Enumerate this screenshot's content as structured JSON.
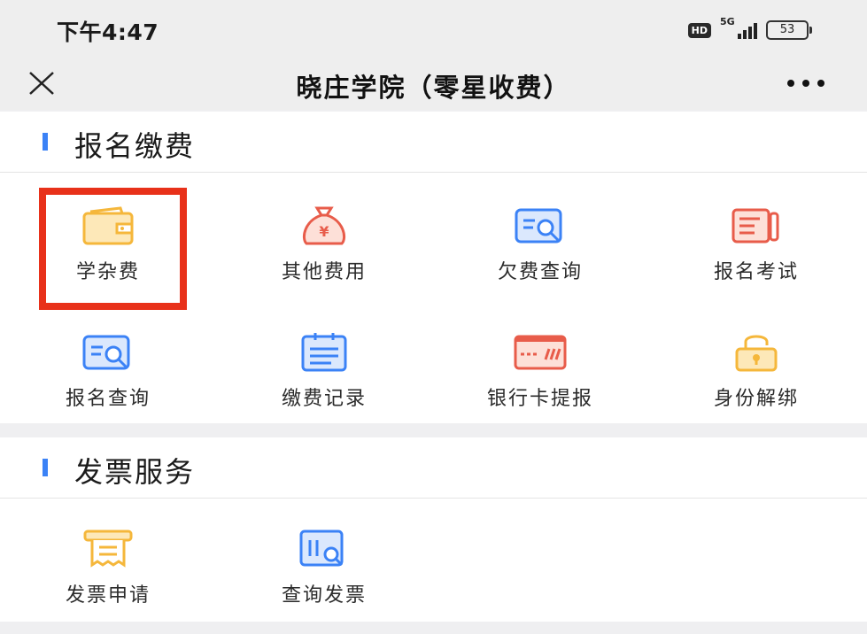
{
  "status_bar": {
    "time": "下午4:47",
    "hd": "HD",
    "network": "5G",
    "battery": "53"
  },
  "header": {
    "title": "晓庄学院（零星收费）",
    "close_icon": "close-icon",
    "more_icon": "more-icon"
  },
  "sections": [
    {
      "title": "报名缴费",
      "items": [
        {
          "label": "学杂费",
          "icon": "wallet-icon",
          "color": "#f5b73b"
        },
        {
          "label": "其他费用",
          "icon": "money-bag-icon",
          "color": "#e85c4a"
        },
        {
          "label": "欠费查询",
          "icon": "document-search-icon",
          "color": "#3b82f6"
        },
        {
          "label": "报名考试",
          "icon": "exam-paper-icon",
          "color": "#e85c4a"
        },
        {
          "label": "报名查询",
          "icon": "document-search-icon",
          "color": "#3b82f6"
        },
        {
          "label": "缴费记录",
          "icon": "clipboard-list-icon",
          "color": "#3b82f6"
        },
        {
          "label": "银行卡提报",
          "icon": "bank-card-icon",
          "color": "#e85c4a"
        },
        {
          "label": "身份解绑",
          "icon": "unlock-icon",
          "color": "#f5b73b"
        }
      ]
    },
    {
      "title": "发票服务",
      "items": [
        {
          "label": "发票申请",
          "icon": "invoice-icon",
          "color": "#f5b73b"
        },
        {
          "label": "查询发票",
          "icon": "invoice-search-icon",
          "color": "#3b82f6"
        }
      ]
    }
  ],
  "colors": {
    "accent_blue": "#3b82f6",
    "accent_red": "#e85c4a",
    "accent_yellow": "#f5b73b",
    "highlight_red": "#e8311a"
  }
}
